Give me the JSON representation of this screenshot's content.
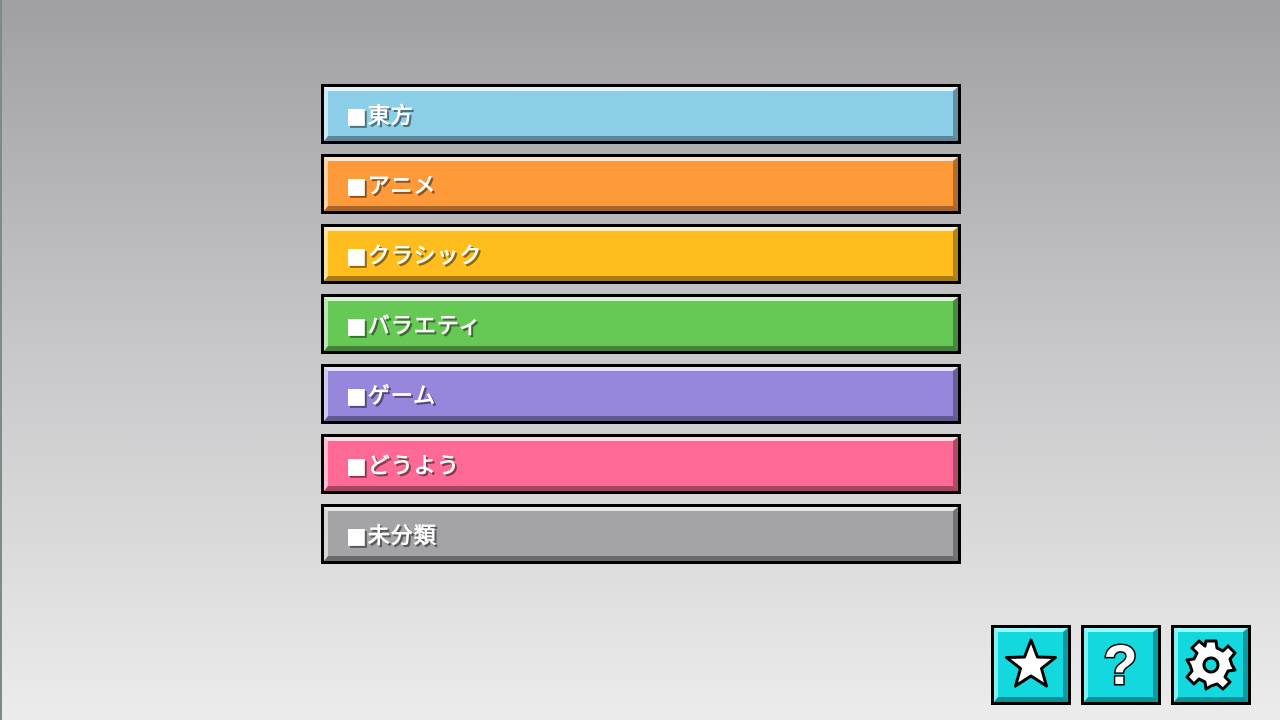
{
  "categories": [
    {
      "label": "■東方",
      "color": "#8ccfe8"
    },
    {
      "label": "■アニメ",
      "color": "#ff9a3a"
    },
    {
      "label": "■クラシック",
      "color": "#ffbe1e"
    },
    {
      "label": "■バラエティ",
      "color": "#66c855"
    },
    {
      "label": "■ゲーム",
      "color": "#9787dc"
    },
    {
      "label": "■どうよう",
      "color": "#ff6996"
    },
    {
      "label": "■未分類",
      "color": "#a4a3a5"
    }
  ],
  "toolbar": {
    "accent": "#13d9de",
    "buttons": [
      {
        "icon": "star-icon"
      },
      {
        "icon": "question-icon",
        "glyph": "?"
      },
      {
        "icon": "gear-icon"
      }
    ]
  }
}
